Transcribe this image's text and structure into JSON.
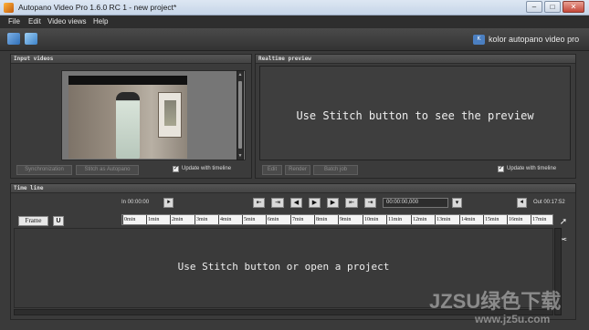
{
  "window": {
    "title": "Autopano Video Pro 1.6.0 RC 1 - new project*",
    "minimize_label": "–",
    "maximize_label": "□",
    "close_label": "✕"
  },
  "menu": [
    "File",
    "Edit",
    "Video views",
    "Help"
  ],
  "toolbar": {
    "icons": [
      "folder-video-icon",
      "new-project-icon"
    ],
    "brand": "kolor autopano video pro",
    "brand_mark": "K"
  },
  "input_videos": {
    "header": "Input videos",
    "synchronization_label": "Synchronization",
    "stitch_label": "Stitch as Autopano",
    "update_checkbox_label": "Update with timeline",
    "update_checked": true
  },
  "realtime_preview": {
    "header": "Realtime preview",
    "message": "Use Stitch button to see the preview",
    "buttons": [
      "Edit",
      "Render",
      "Batch job"
    ],
    "update_checkbox_label": "Update with timeline",
    "update_checked": true
  },
  "timeline": {
    "header": "Time line",
    "in_label": "In 00:00:00",
    "out_label": "Out 00:17:52",
    "current_time": "00:00:00,000",
    "frame_button": "Frame",
    "u_button": "U",
    "ruler_ticks": [
      "0min",
      "1min",
      "2min",
      "3min",
      "4min",
      "5min",
      "6min",
      "7min",
      "8min",
      "9min",
      "10min",
      "11min",
      "12min",
      "13min",
      "14min",
      "15min",
      "16min",
      "17min"
    ],
    "message": "Use Stitch button or open a project"
  },
  "watermark": {
    "line1": "JZSU绿色下载",
    "line2": "www.jz5u.com"
  }
}
